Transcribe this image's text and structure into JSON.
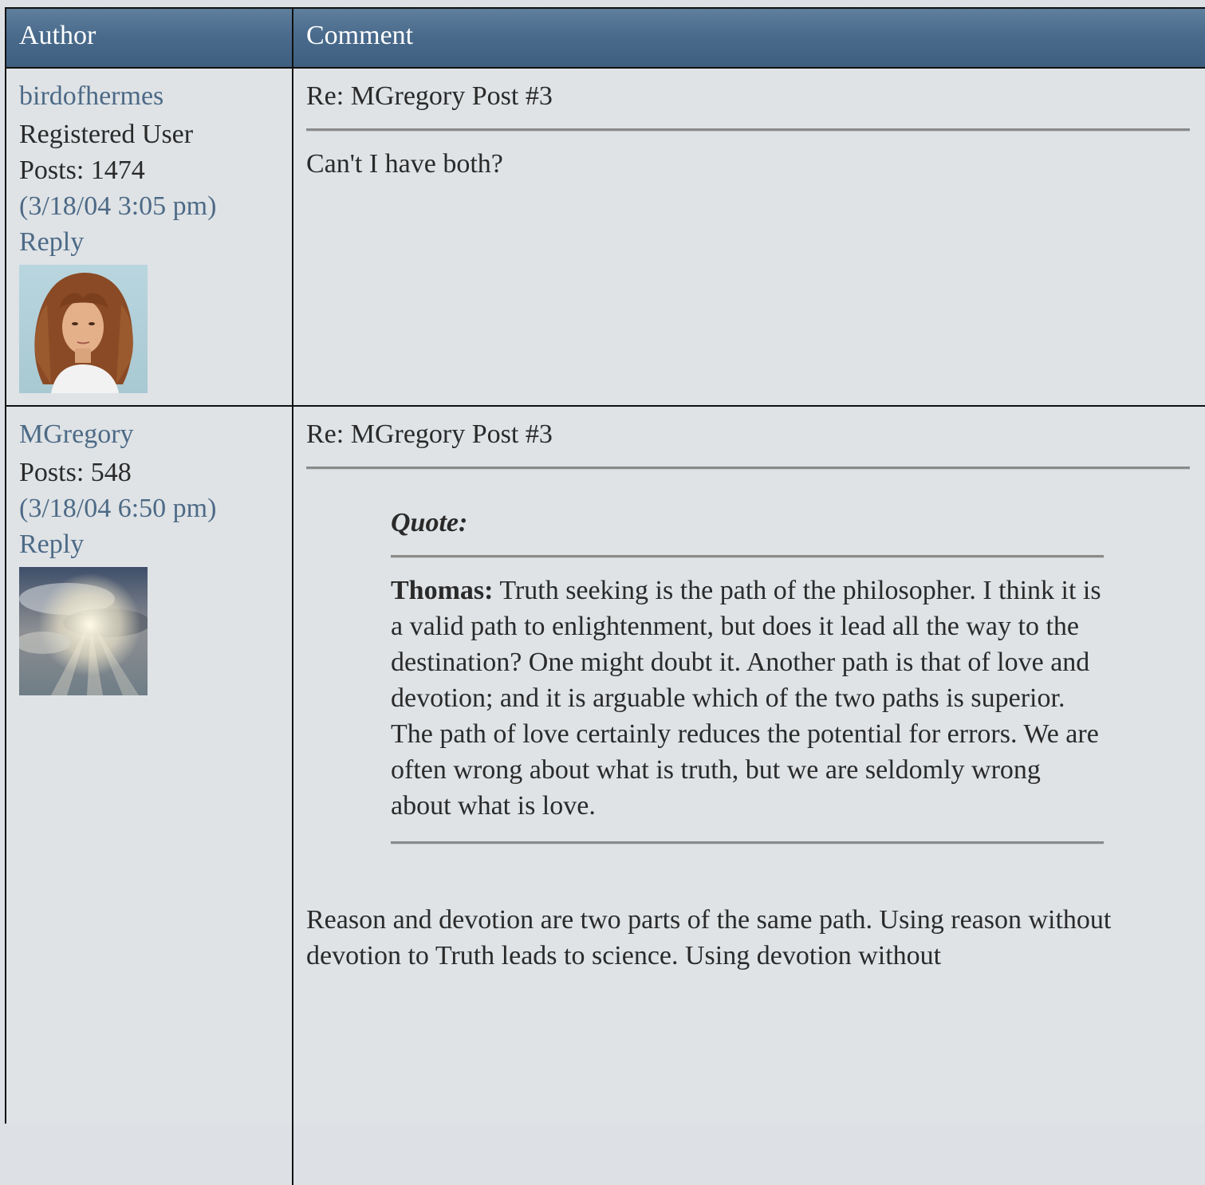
{
  "header": {
    "author_label": "Author",
    "comment_label": "Comment"
  },
  "posts": [
    {
      "author": "birdofhermes",
      "role": "Registered User",
      "posts_count": "Posts: 1474",
      "timestamp": "(3/18/04 3:05 pm)",
      "reply_label": "Reply",
      "avatar_icon": "portrait-woman-curly-hair-avatar",
      "subject": "Re: MGregory Post #3",
      "body": "Can't I have both?"
    },
    {
      "author": "MGregory",
      "posts_count": "Posts: 548",
      "timestamp": "(3/18/04 6:50 pm)",
      "reply_label": "Reply",
      "avatar_icon": "sky-sunrays-clouds-avatar",
      "subject": "Re: MGregory Post #3",
      "quote_label": "Quote:",
      "quote_author": "Thomas:",
      "quote_text": " Truth seeking is the path of the philosopher. I think it is a valid path to enlightenment, but does it lead all the way to the destination? One might doubt it. Another path is that of love and devotion; and it is arguable which of the two paths is superior. The path of love certainly reduces the potential for errors. We are often wrong about what is truth, but we are seldomly wrong about what is love.",
      "body": "Reason and devotion are two parts of the same path. Using reason without devotion to Truth leads to science. Using devotion without"
    }
  ],
  "colors": {
    "header_bg": "#4a6b8c",
    "link": "#4d6a86",
    "row_bg": "#dfe3e6",
    "border": "#111111"
  }
}
